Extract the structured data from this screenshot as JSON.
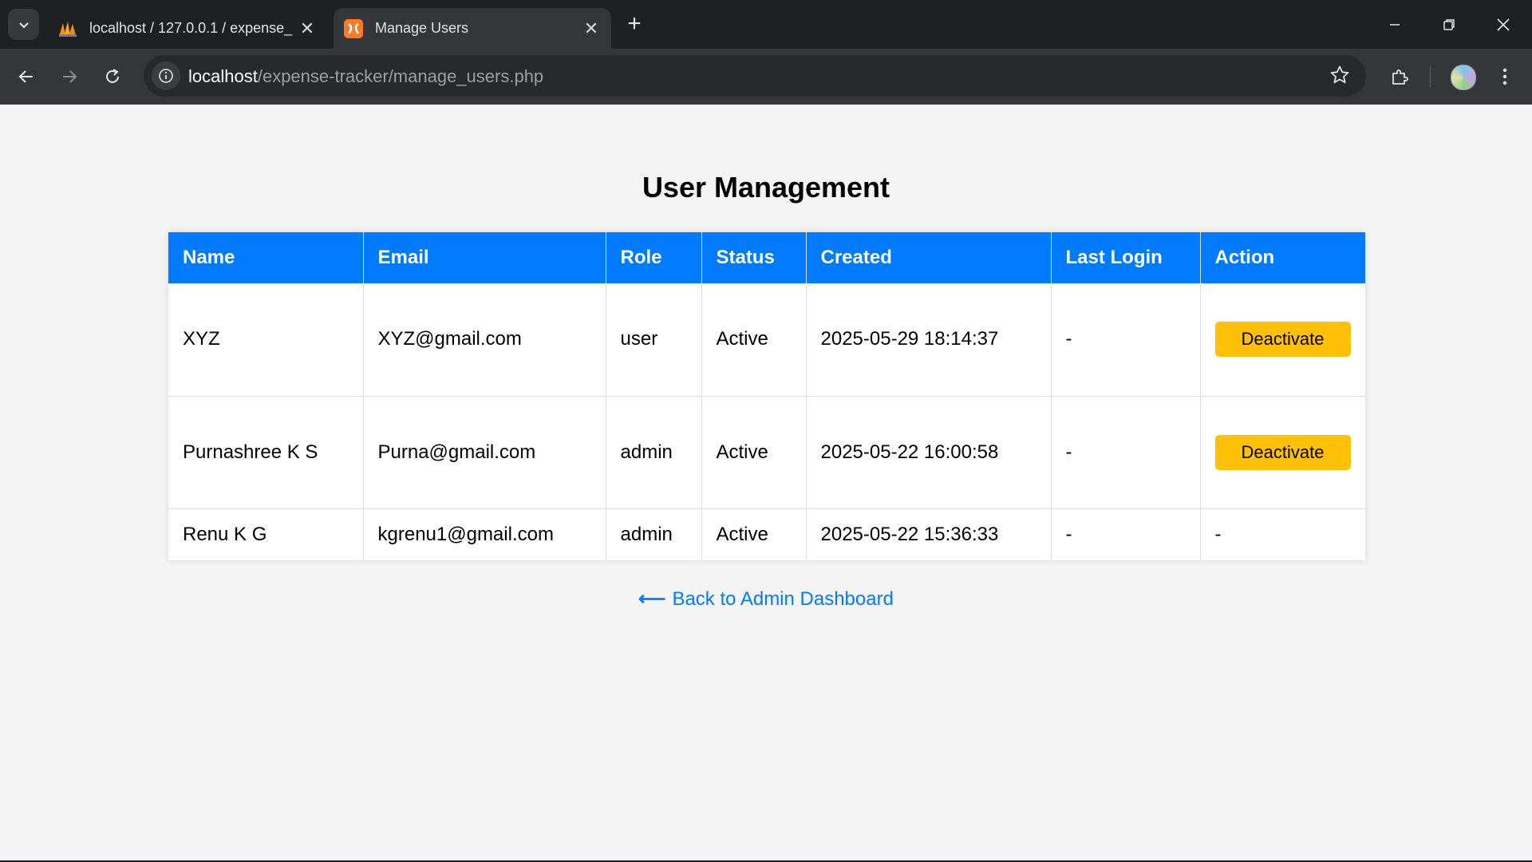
{
  "browser": {
    "tabs": [
      {
        "title": "localhost / 127.0.0.1 / expense_",
        "active": false,
        "favicon": "phpmyadmin-icon"
      },
      {
        "title": "Manage Users",
        "active": true,
        "favicon": "xampp-icon"
      }
    ],
    "url_host": "localhost",
    "url_path": "/expense-tracker/manage_users.php"
  },
  "page": {
    "title": "User Management",
    "back_link": "Back to Admin Dashboard",
    "back_arrow": "⟵"
  },
  "table": {
    "headers": [
      "Name",
      "Email",
      "Role",
      "Status",
      "Created",
      "Last Login",
      "Action"
    ],
    "rows": [
      {
        "name": "XYZ",
        "email": "XYZ@gmail.com",
        "role": "user",
        "status": "Active",
        "created": "2025-05-29 18:14:37",
        "last_login": "-",
        "action": "Deactivate"
      },
      {
        "name": "Purnashree K S",
        "email": "Purna@gmail.com",
        "role": "admin",
        "status": "Active",
        "created": "2025-05-22 16:00:58",
        "last_login": "-",
        "action": "Deactivate"
      },
      {
        "name": "Renu K G",
        "email": "kgrenu1@gmail.com",
        "role": "admin",
        "status": "Active",
        "created": "2025-05-22 15:36:33",
        "last_login": "-",
        "action": "-"
      }
    ]
  },
  "colors": {
    "header_bg": "#007bff",
    "button_bg": "#ffc107",
    "link": "#007bff",
    "page_bg": "#f4f4f4"
  }
}
